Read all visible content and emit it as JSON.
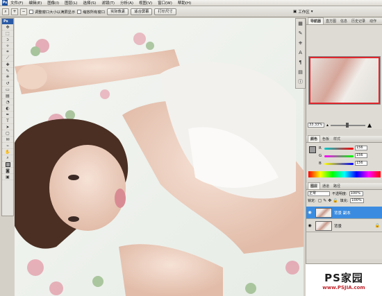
{
  "menu": {
    "items": [
      "文件(F)",
      "编辑(E)",
      "图像(I)",
      "图层(L)",
      "选择(S)",
      "滤镜(T)",
      "分析(A)",
      "视图(V)",
      "窗口(W)",
      "帮助(H)"
    ]
  },
  "options": {
    "resize_windows": "调整窗口大小以满屏显示",
    "zoom_all": "缩放所有窗口",
    "actual_pixels": "实际像素",
    "fit_screen": "适合屏幕",
    "print_size": "打印尺寸"
  },
  "workspace": {
    "label": "工作区"
  },
  "toolbox": {
    "logo": "Ps"
  },
  "navigator": {
    "tabs": [
      "导航器",
      "直方图",
      "信息",
      "历史记录",
      "动作"
    ],
    "zoom": "33.33%"
  },
  "color": {
    "tabs": [
      "颜色",
      "色板",
      "样式"
    ],
    "r_label": "R",
    "g_label": "G",
    "b_label": "B",
    "r": "156",
    "g": "156",
    "b": "156"
  },
  "layers": {
    "tabs": [
      "图层",
      "通道",
      "路径"
    ],
    "blend_mode": "正常",
    "opacity_label": "不透明度:",
    "opacity": "100%",
    "lock_label": "锁定:",
    "fill_label": "填充:",
    "fill": "100%",
    "items": [
      {
        "name": "背景 副本",
        "selected": true
      },
      {
        "name": "背景",
        "selected": false
      }
    ]
  },
  "watermark": {
    "brand": "PS家园",
    "url": "www.PSJIA.com"
  }
}
